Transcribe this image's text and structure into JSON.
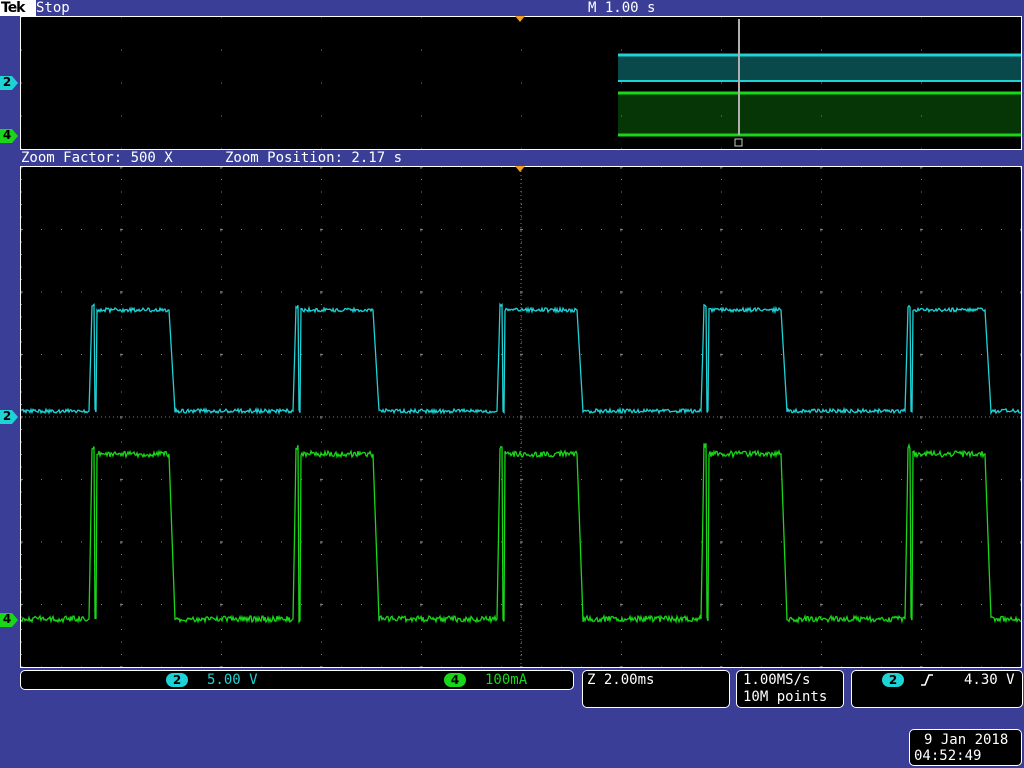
{
  "header": {
    "brand": "Tek",
    "run_state": "Stop",
    "main_timebase": "M 1.00 s"
  },
  "zoom": {
    "factor_text": "Zoom Factor: 500 X",
    "position_text": "Zoom Position: 2.17 s"
  },
  "channels": [
    {
      "id": "2",
      "color": "#1ed2d6",
      "scale": "5.00 V"
    },
    {
      "id": "4",
      "color": "#19d619",
      "scale": "100mA"
    }
  ],
  "zoom_scale": "Z 2.00ms",
  "acquisition": {
    "sample_rate": "1.00MS/s",
    "record_length": "10M points"
  },
  "trigger": {
    "source": "2",
    "slope": "rising",
    "level": "4.30 V"
  },
  "datetime": {
    "date": "9 Jan  2018",
    "time": "04:52:49"
  },
  "colors": {
    "background": "#3a3e96",
    "ch2": "#1ed2d6",
    "ch4": "#19d619",
    "trigger_marker": "#f0a020",
    "grid": "#7a7a7a"
  }
}
